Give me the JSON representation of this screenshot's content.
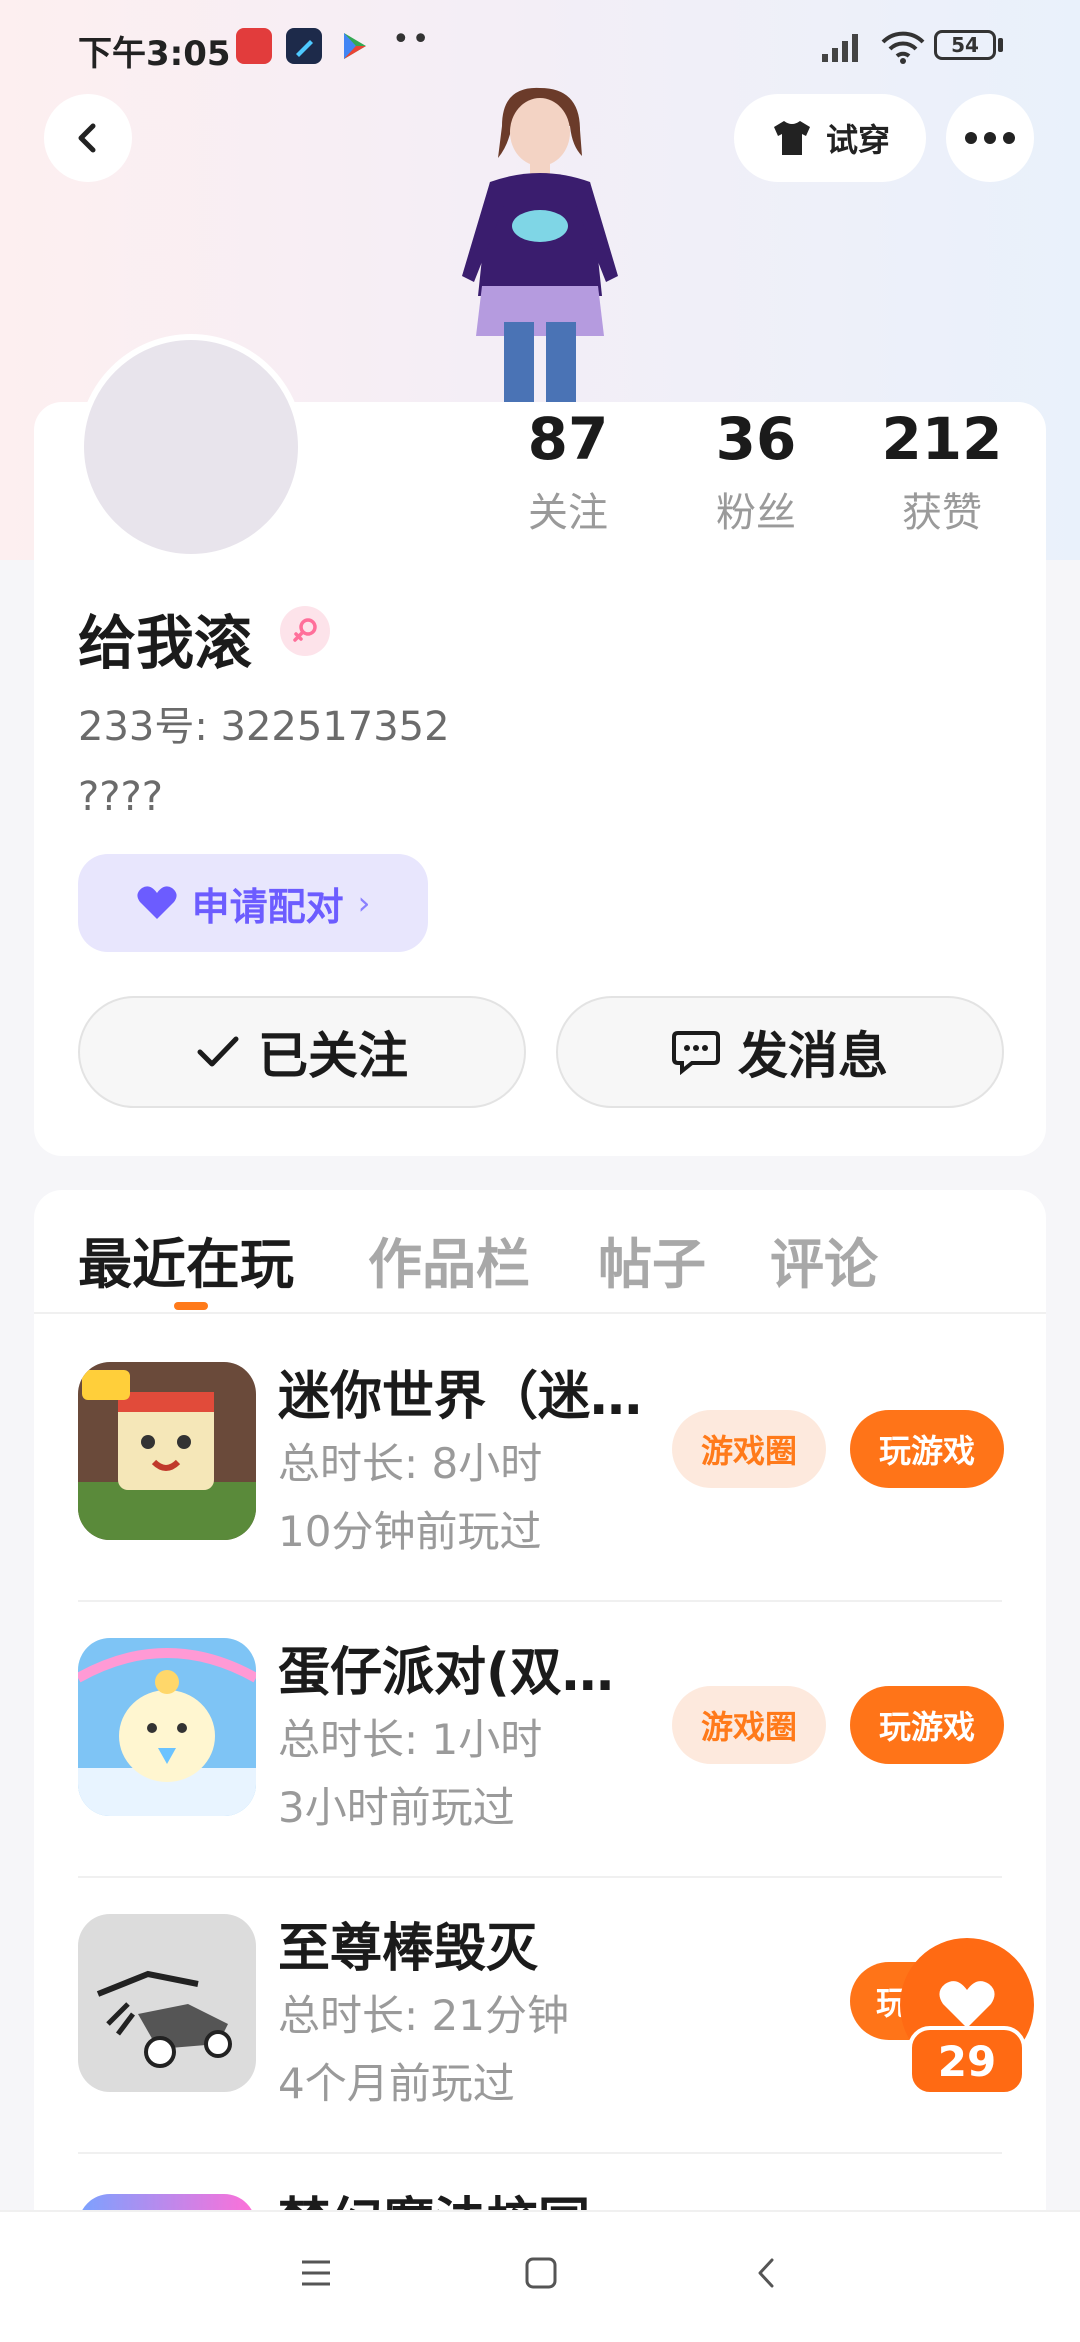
{
  "status_bar": {
    "time": "下午3:05",
    "battery": "54"
  },
  "header": {
    "try_on_label": "试穿"
  },
  "profile": {
    "stats": [
      {
        "value": "87",
        "label": "关注"
      },
      {
        "value": "36",
        "label": "粉丝"
      },
      {
        "value": "212",
        "label": "获赞"
      }
    ],
    "name": "给我滚",
    "uid": "233号: 322517352",
    "bio": "????",
    "match_label": "申请配对",
    "follow_label": "已关注",
    "message_label": "发消息"
  },
  "tabs": [
    "最近在玩",
    "作品栏",
    "帖子",
    "评论"
  ],
  "games": [
    {
      "title": "迷你世界（迷…",
      "duration": "总时长: 8小时",
      "last_played": "10分钟前玩过",
      "circle_label": "游戏圈",
      "play_label": "玩游戏"
    },
    {
      "title": "蛋仔派对(双…",
      "duration": "总时长: 1小时",
      "last_played": "3小时前玩过",
      "circle_label": "游戏圈",
      "play_label": "玩游戏"
    },
    {
      "title": "至尊棒毁灭",
      "duration": "总时长: 21分钟",
      "last_played": "4个月前玩过",
      "play_label": "玩"
    },
    {
      "title": "梦幻魔法校园"
    }
  ],
  "like_float": {
    "count": "29"
  },
  "colors": {
    "accent": "#ff7418",
    "match": "#6c5cff"
  }
}
